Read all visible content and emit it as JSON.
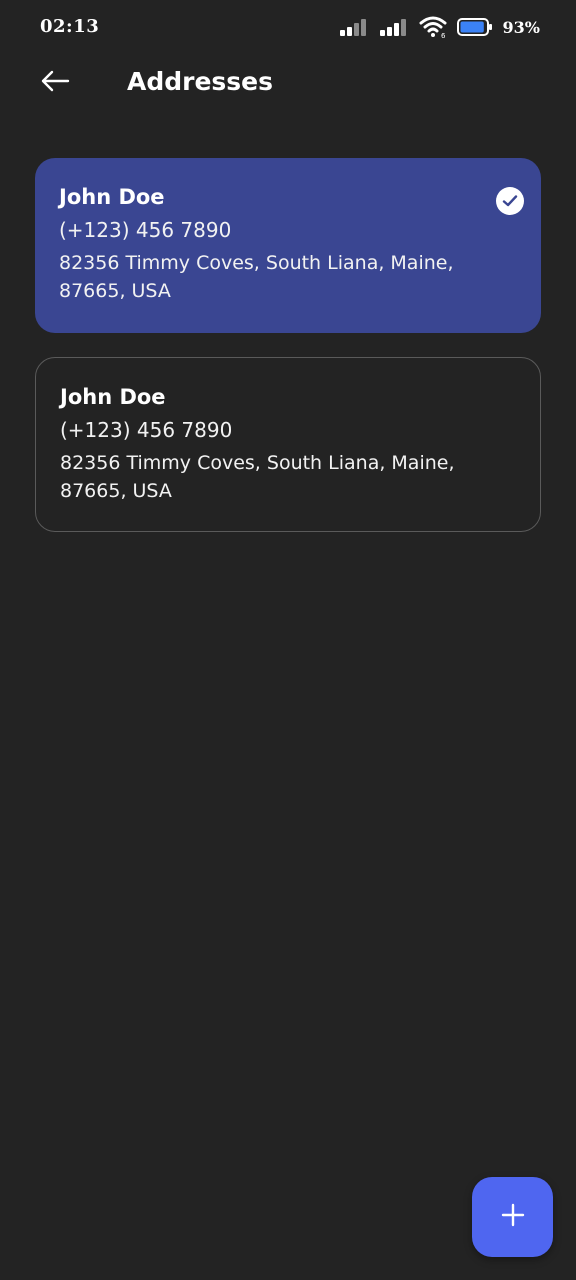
{
  "status_bar": {
    "time": "02:13",
    "battery_percent": "93%",
    "battery_level": 0.93,
    "icons": [
      "signal-icon",
      "signal-icon",
      "wifi-icon",
      "battery-icon"
    ]
  },
  "app_bar": {
    "back_icon": "arrow-left-icon",
    "title": "Addresses"
  },
  "addresses": [
    {
      "name": "John Doe",
      "phone": "(+123) 456 7890",
      "address": "82356 Timmy Coves, South Liana, Maine, 87665, USA",
      "selected": true
    },
    {
      "name": "John Doe",
      "phone": "(+123) 456 7890",
      "address": "82356 Timmy Coves, South Liana, Maine, 87665, USA",
      "selected": false
    }
  ],
  "fab": {
    "icon": "plus-icon"
  },
  "colors": {
    "background": "#232323",
    "selected_card": "#3a4692",
    "card_border": "#5a5a5a",
    "fab": "#4f66f0",
    "text": "#ffffff"
  }
}
